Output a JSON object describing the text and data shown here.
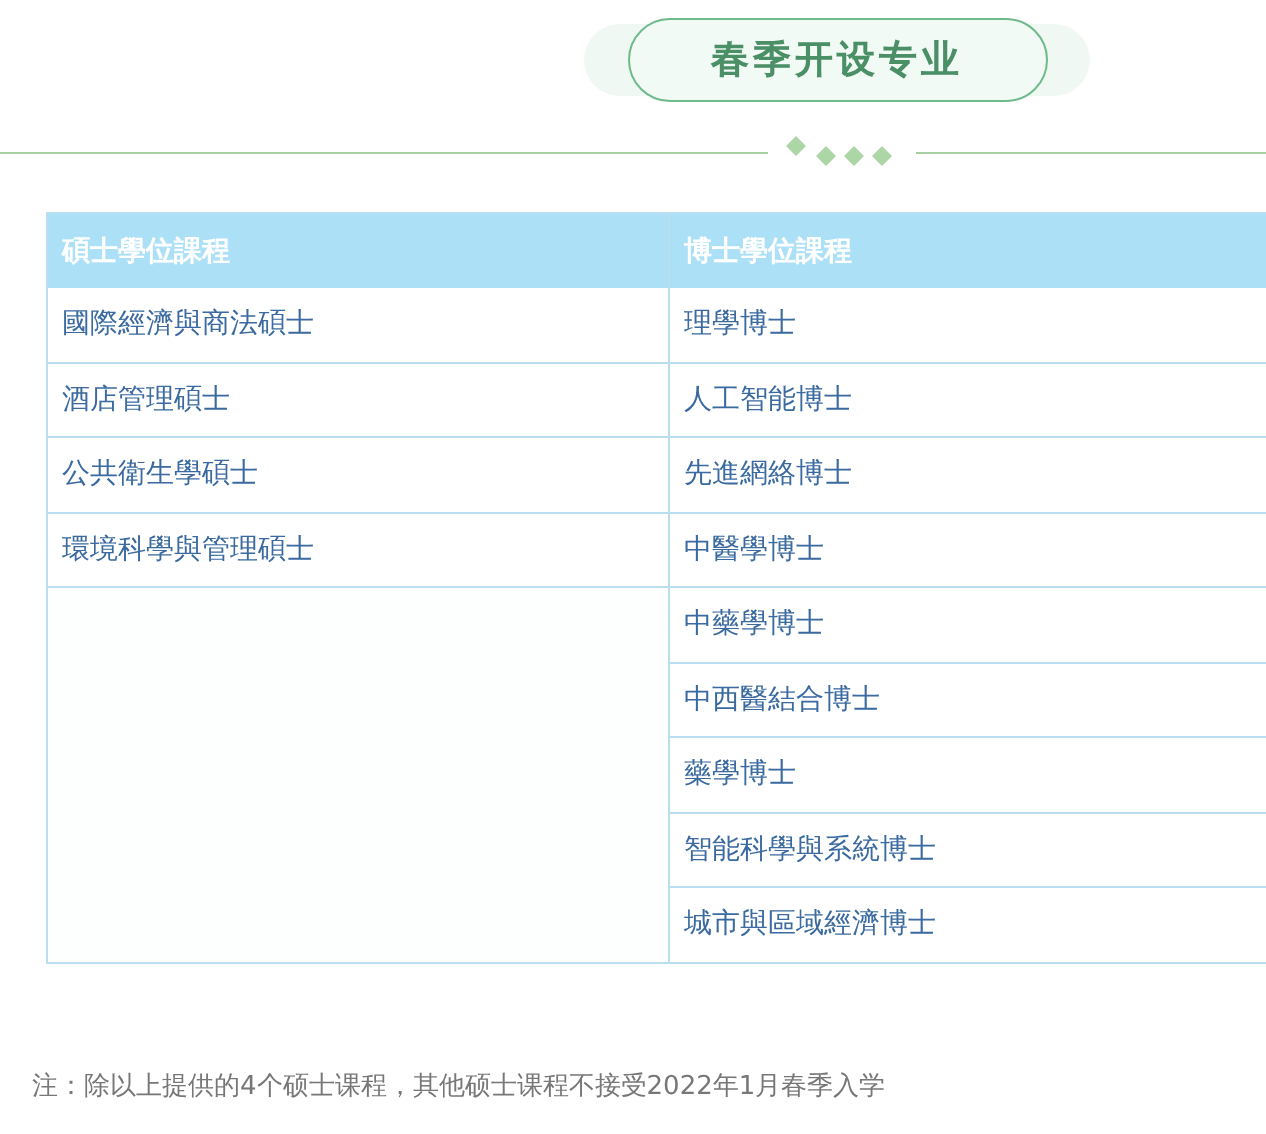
{
  "title": "春季开设专业",
  "table": {
    "columns": [
      "碩士學位課程",
      "博士學位課程"
    ],
    "masters": [
      "國際經濟與商法碩士",
      "酒店管理碩士",
      "公共衛生學碩士",
      "環境科學與管理碩士"
    ],
    "doctorates": [
      "理學博士",
      "人工智能博士",
      "先進網絡博士",
      "中醫學博士",
      "中藥學博士",
      "中西醫結合博士",
      "藥學博士",
      "智能科學與系統博士",
      "城市與區域經濟博士"
    ]
  },
  "note": "注：除以上提供的4个硕士课程，其他硕士课程不接受2022年1月春季入学"
}
